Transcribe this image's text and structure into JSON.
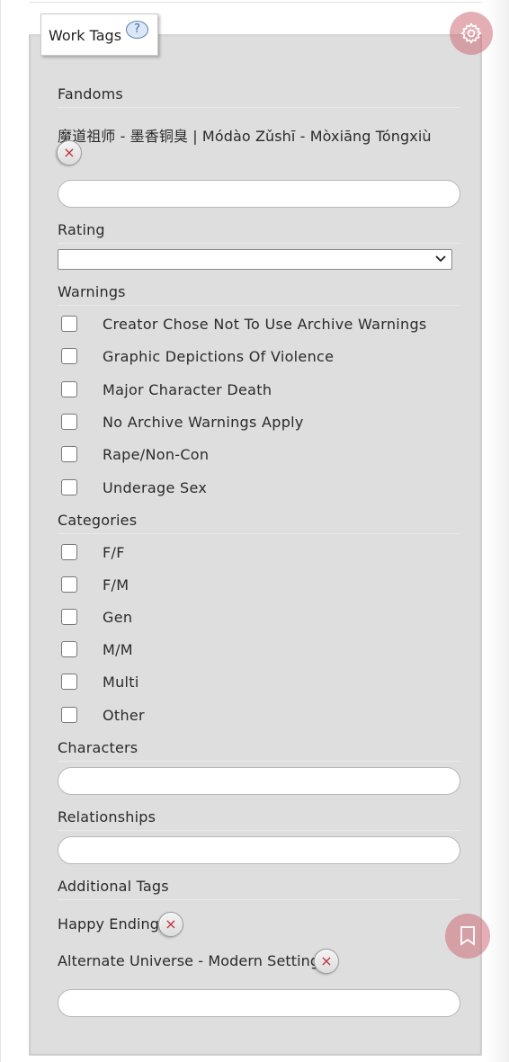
{
  "legend": {
    "label": "Work Tags",
    "help": "?"
  },
  "icons": {
    "gear": "gear-icon",
    "bookmark": "bookmark-icon",
    "remove": "close-icon"
  },
  "colors": {
    "panel_bg": "#dedede",
    "floating_button": "#d98c93",
    "remove_x": "#c0303a"
  },
  "fandoms": {
    "label": "Fandoms",
    "tags": [
      {
        "text": "魔道祖师 - 墨香铜臭 | Módào Zǔshī - Mòxiāng Tóngxiù",
        "remove": "×"
      }
    ],
    "input_value": ""
  },
  "rating": {
    "label": "Rating",
    "selected": ""
  },
  "warnings": {
    "label": "Warnings",
    "options": [
      "Creator Chose Not To Use Archive Warnings",
      "Graphic Depictions Of Violence",
      "Major Character Death",
      "No Archive Warnings Apply",
      "Rape/Non-Con",
      "Underage Sex"
    ]
  },
  "categories": {
    "label": "Categories",
    "options": [
      "F/F",
      "F/M",
      "Gen",
      "M/M",
      "Multi",
      "Other"
    ]
  },
  "characters": {
    "label": "Characters",
    "input_value": ""
  },
  "relationships": {
    "label": "Relationships",
    "input_value": ""
  },
  "additional_tags": {
    "label": "Additional Tags",
    "tags": [
      {
        "text": "Happy Ending",
        "remove": "×"
      },
      {
        "text": "Alternate Universe - Modern Setting",
        "remove": "×"
      }
    ],
    "input_value": ""
  }
}
